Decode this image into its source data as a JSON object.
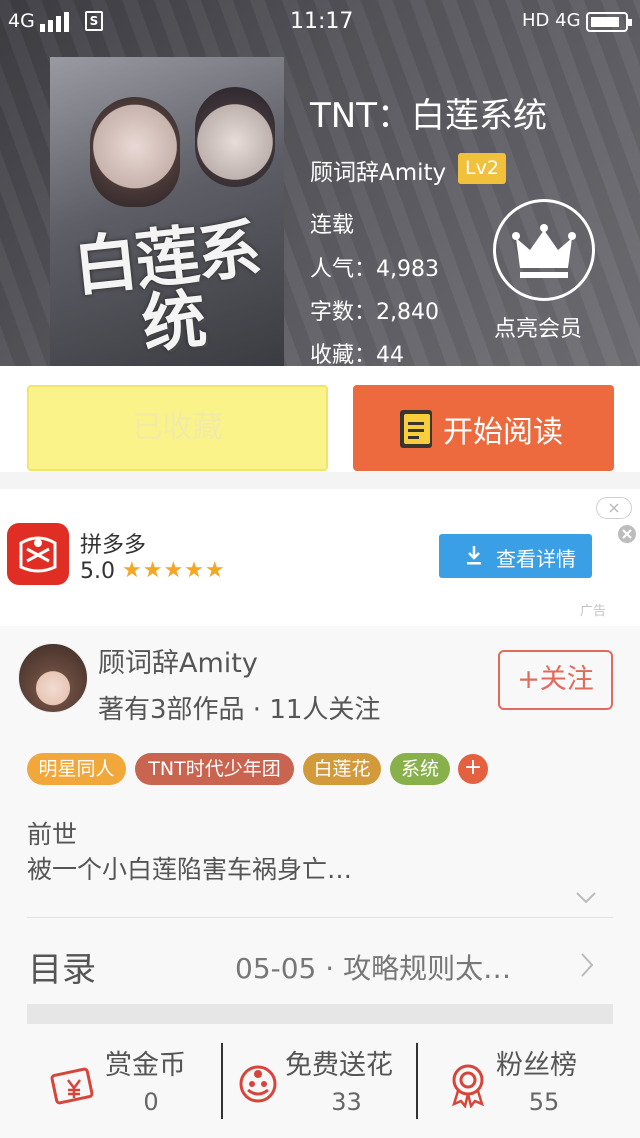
{
  "status_bar": {
    "network_left": "4G",
    "time": "11:17",
    "network_right": "HD 4G"
  },
  "book": {
    "title": "TNT：白莲系统",
    "author": "顾词辞Amity",
    "level": "Lv2",
    "status": "连载",
    "popularity": "人气：4,983",
    "word_count": "字数：2,840",
    "favorites": "收藏：44",
    "cover_title": "白莲系统"
  },
  "member": {
    "label": "点亮会员",
    "icon": "crown-icon"
  },
  "actions": {
    "collected_label": "已收藏",
    "read_label": "开始阅读"
  },
  "ad": {
    "app_name": "拼多多",
    "rating": "5.0",
    "stars": "★★★★★",
    "button_label": "查看详情",
    "tag": "广告"
  },
  "author_card": {
    "name": "顾词辞Amity",
    "works": "著有3部作品 · 11人关注",
    "follow_label": "+关注"
  },
  "tags": [
    {
      "label": "明星同人",
      "color": "#f2a73a"
    },
    {
      "label": "TNT时代少年团",
      "color": "#c8644f"
    },
    {
      "label": "白莲花",
      "color": "#d39a3c"
    },
    {
      "label": "系统",
      "color": "#88b04b"
    }
  ],
  "tag_add": "+",
  "synopsis": {
    "line1": "前世",
    "line2": "被一个小白莲陷害车祸身亡…"
  },
  "toc": {
    "label": "目录",
    "latest": "05-05 · 攻略规则太…"
  },
  "bottom": [
    {
      "label": "赏金币",
      "count": "0",
      "icon": "reward-coin-icon"
    },
    {
      "label": "免费送花",
      "count": "33",
      "icon": "flower-icon"
    },
    {
      "label": "粉丝榜",
      "count": "55",
      "icon": "medal-icon"
    }
  ],
  "colors": {
    "accent_orange": "#ed6a3f",
    "collected_yellow": "#faf38a",
    "ad_blue": "#3a9fe4",
    "follow_red": "#e06a5c",
    "level_badge": "#f2c13c"
  }
}
